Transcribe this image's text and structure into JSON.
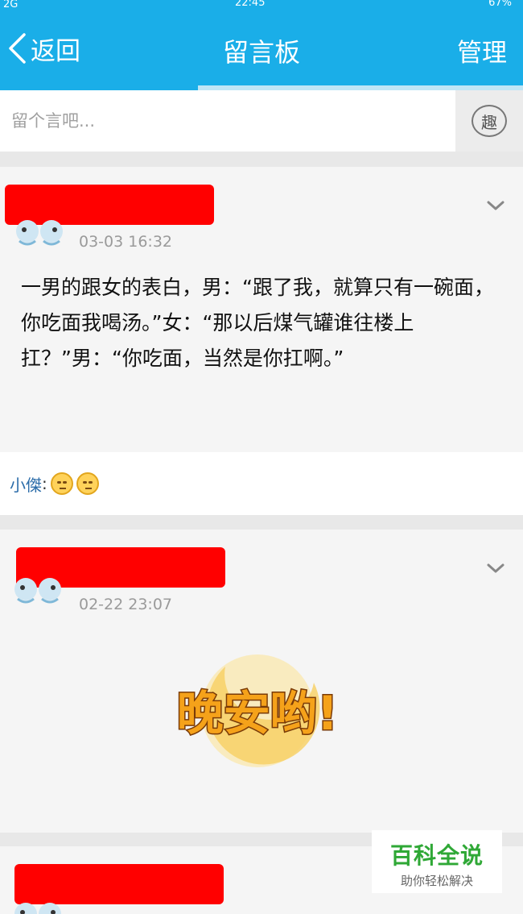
{
  "status_bar": {
    "network": "2G",
    "time": "22:45",
    "battery": "67%"
  },
  "header": {
    "back_label": "返回",
    "title": "留言板",
    "manage_label": "管理"
  },
  "compose": {
    "placeholder": "留个言吧...",
    "fun_label": "趣"
  },
  "posts": [
    {
      "time": "03-03 16:32",
      "content": "一男的跟女的表白，男：“跟了我，就算只有一碗面，你吃面我喝汤。”女：“那以后煤气罐谁往楼上扛？”男：“你吃面，当然是你扛啊。”",
      "comment": {
        "author": "小傑",
        "colon": ":"
      }
    },
    {
      "time": "02-22 23:07",
      "sticker_text": "晚安哟!"
    }
  ],
  "watermark": {
    "title": "百科全说",
    "subtitle": "助你轻松解决"
  },
  "colors": {
    "accent": "#1aaee8",
    "redaction": "#ff0000",
    "commenter": "#2b6ca9"
  }
}
